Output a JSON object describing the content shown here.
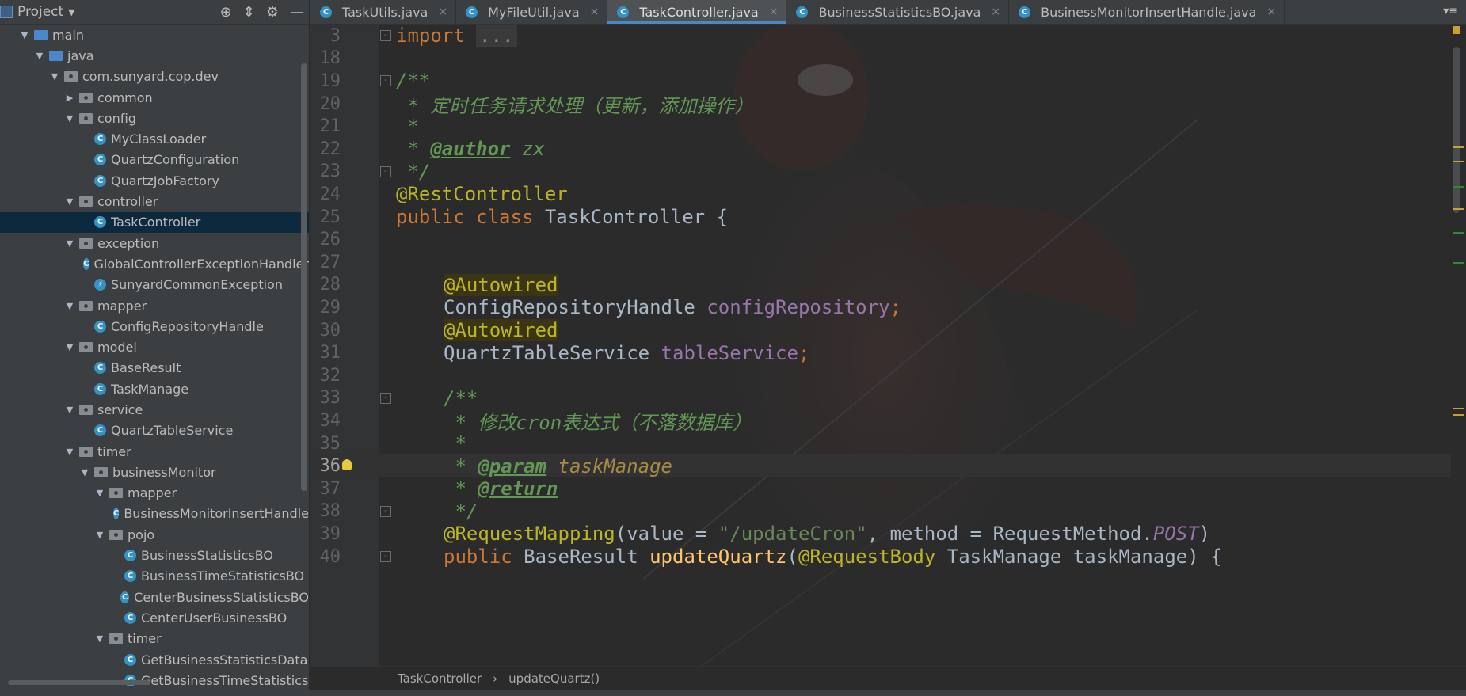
{
  "project_panel": {
    "title": "Project",
    "tree": [
      {
        "label": "main",
        "depth": 1,
        "icon": "folder-blue",
        "expanded": true
      },
      {
        "label": "java",
        "depth": 2,
        "icon": "folder-blue",
        "expanded": true
      },
      {
        "label": "com.sunyard.cop.dev",
        "depth": 3,
        "icon": "package",
        "expanded": true
      },
      {
        "label": "common",
        "depth": 4,
        "icon": "package",
        "expanded": false
      },
      {
        "label": "config",
        "depth": 4,
        "icon": "package",
        "expanded": true
      },
      {
        "label": "MyClassLoader",
        "depth": 5,
        "icon": "class"
      },
      {
        "label": "QuartzConfiguration",
        "depth": 5,
        "icon": "class"
      },
      {
        "label": "QuartzJobFactory",
        "depth": 5,
        "icon": "class"
      },
      {
        "label": "controller",
        "depth": 4,
        "icon": "package",
        "expanded": true
      },
      {
        "label": "TaskController",
        "depth": 5,
        "icon": "class",
        "selected": true
      },
      {
        "label": "exception",
        "depth": 4,
        "icon": "package",
        "expanded": true
      },
      {
        "label": "GlobalControllerExceptionHandler",
        "depth": 5,
        "icon": "class"
      },
      {
        "label": "SunyardCommonException",
        "depth": 5,
        "icon": "exception-class"
      },
      {
        "label": "mapper",
        "depth": 4,
        "icon": "package",
        "expanded": true
      },
      {
        "label": "ConfigRepositoryHandle",
        "depth": 5,
        "icon": "class"
      },
      {
        "label": "model",
        "depth": 4,
        "icon": "package",
        "expanded": true
      },
      {
        "label": "BaseResult",
        "depth": 5,
        "icon": "class"
      },
      {
        "label": "TaskManage",
        "depth": 5,
        "icon": "class"
      },
      {
        "label": "service",
        "depth": 4,
        "icon": "package",
        "expanded": true
      },
      {
        "label": "QuartzTableService",
        "depth": 5,
        "icon": "class"
      },
      {
        "label": "timer",
        "depth": 4,
        "icon": "package",
        "expanded": true
      },
      {
        "label": "businessMonitor",
        "depth": 5,
        "icon": "package",
        "expanded": true
      },
      {
        "label": "mapper",
        "depth": 6,
        "icon": "package",
        "expanded": true
      },
      {
        "label": "BusinessMonitorInsertHandle",
        "depth": 7,
        "icon": "class"
      },
      {
        "label": "pojo",
        "depth": 6,
        "icon": "package",
        "expanded": true
      },
      {
        "label": "BusinessStatisticsBO",
        "depth": 7,
        "icon": "class"
      },
      {
        "label": "BusinessTimeStatisticsBO",
        "depth": 7,
        "icon": "class"
      },
      {
        "label": "CenterBusinessStatisticsBO",
        "depth": 7,
        "icon": "class"
      },
      {
        "label": "CenterUserBusinessBO",
        "depth": 7,
        "icon": "class"
      },
      {
        "label": "timer",
        "depth": 6,
        "icon": "package",
        "expanded": true
      },
      {
        "label": "GetBusinessStatisticsData",
        "depth": 7,
        "icon": "class"
      },
      {
        "label": "GetBusinessTimeStatistics",
        "depth": 7,
        "icon": "class"
      }
    ]
  },
  "tabs": [
    {
      "label": "TaskUtils.java",
      "active": false
    },
    {
      "label": "MyFileUtil.java",
      "active": false
    },
    {
      "label": "TaskController.java",
      "active": true
    },
    {
      "label": "BusinessStatisticsBO.java",
      "active": false
    },
    {
      "label": "BusinessMonitorInsertHandle.java",
      "active": false
    }
  ],
  "editor": {
    "line_numbers": [
      "3",
      "18",
      "19",
      "20",
      "21",
      "22",
      "23",
      "24",
      "25",
      "26",
      "27",
      "28",
      "29",
      "30",
      "31",
      "32",
      "33",
      "34",
      "35",
      "36",
      "37",
      "38",
      "39",
      "40"
    ],
    "current_line": "36",
    "code": {
      "l3_kw": "import",
      "l3_fold": "...",
      "l19": "/**",
      "l20": " * 定时任务请求处理（更新，添加操作）",
      "l21": " *",
      "l22_pre": " * ",
      "l22_tag": "@author",
      "l22_post": " zx",
      "l23": " */",
      "l24": "@RestController",
      "l25_kw": "public class",
      "l25_name": " TaskController {",
      "l28": "@Autowired",
      "l29_type": "ConfigRepositoryHandle ",
      "l29_field": "configRepository",
      "l29_semi": ";",
      "l30": "@Autowired",
      "l31_type": "QuartzTableService ",
      "l31_field": "tableService",
      "l31_semi": ";",
      "l33": "/**",
      "l34": " * 修改cron表达式（不落数据库）",
      "l35": " *",
      "l36_pre": " * ",
      "l36_tag": "@param",
      "l36_param": " taskManage",
      "l37_pre": " * ",
      "l37_tag": "@return",
      "l38": " */",
      "l39_ann": "@RequestMapping",
      "l39_p1": "(value = ",
      "l39_str": "\"/updateCron\"",
      "l39_p2": ", method = RequestMethod.",
      "l39_const": "POST",
      "l39_p3": ")",
      "l40_kw": "public",
      "l40_type": " BaseResult ",
      "l40_method": "updateQuartz",
      "l40_p1": "(",
      "l40_ann": "@RequestBody",
      "l40_p2": " TaskManage taskManage) {"
    }
  },
  "breadcrumb": {
    "class": "TaskController",
    "method": "updateQuartz()"
  },
  "colors": {
    "keyword": "#cc7832",
    "comment": "#629755",
    "annotation": "#bbb529",
    "field": "#9876aa",
    "string": "#6a8759",
    "method": "#ffc66d",
    "selection": "#0d293e",
    "active_tab_underline": "#4a88c7"
  }
}
